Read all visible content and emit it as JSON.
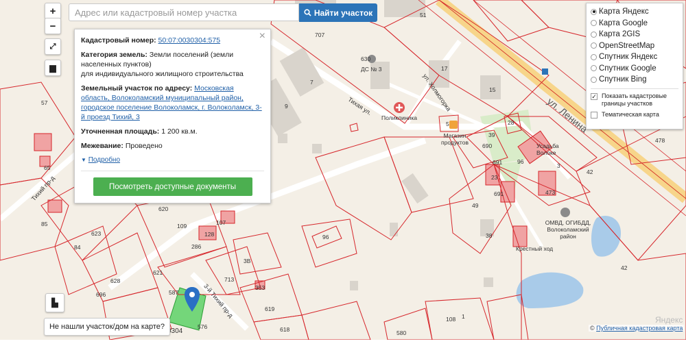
{
  "search": {
    "placeholder": "Адрес или кадастровый номер участка",
    "button_label": "Найти участок"
  },
  "map_controls": {
    "zoom_in": "+",
    "zoom_out": "−"
  },
  "info_popup": {
    "cadastral_label": "Кадастровый номер:",
    "cadastral_value": "50:07:0030304:575",
    "category_label": "Категория земель:",
    "category_value": "Земли поселений (земли населенных пунктов)",
    "usage_value": "для индивидуального жилищного строительства",
    "address_label": "Земельный участок по адресу:",
    "address_value": "Московская область, Волоколамский муниципальный район, городское поселение Волоколамск, г. Волоколамск, 3-й проезд Тихий, 3",
    "area_label": "Уточненная площадь:",
    "area_value": "1 200 кв.м.",
    "survey_label": "Межевание:",
    "survey_value": "Проведено",
    "more_label": "Подробно",
    "docs_button": "Посмотреть доступные документы",
    "close": "×"
  },
  "layers": {
    "options": [
      {
        "label": "Карта Яндекс",
        "selected": true
      },
      {
        "label": "Карта Google",
        "selected": false
      },
      {
        "label": "Карта 2GIS",
        "selected": false
      },
      {
        "label": "OpenStreetMap",
        "selected": false
      },
      {
        "label": "Спутник Яндекс",
        "selected": false
      },
      {
        "label": "Спутник Google",
        "selected": false
      },
      {
        "label": "Спутник Bing",
        "selected": false
      }
    ],
    "show_cadastral": {
      "label": "Показать кадастровые границы участков",
      "checked": true
    },
    "thematic": {
      "label": "Тематическая карта",
      "checked": false
    }
  },
  "not_found_button": "Не нашли участок/дом на карте?",
  "copyright": {
    "prefix": "©",
    "link": "Публичная кадастровая карта"
  },
  "map_labels": {
    "street_lenina": "ул. Ленина",
    "street_tikhaya": "Тихая ул.",
    "street_kholmogorka": "ул. Холмогорка",
    "street_3_tikhy": "3-й Тихий пр-д",
    "street_tikhy_left": "Тихий пр-д",
    "poi_ds3": "ДС № 3",
    "poi_clinic": "Поликлиника",
    "poi_shop": "Магазин продуктов",
    "poi_omvd": "ОМВД, ОГИБДД, Волоколамский район",
    "poi_usadba": "Усадьба Волоке",
    "poi_church": "Крестный ход",
    "yandex_mark": "Яндекс",
    "parcel_code": "0304",
    "numbers": [
      "51",
      "707",
      "17",
      "15",
      "7",
      "9",
      "630",
      "5",
      "57",
      "65",
      "23",
      "39",
      "28",
      "690",
      "691",
      "691",
      "473",
      "96",
      "3",
      "42",
      "49",
      "620",
      "109",
      "107",
      "128",
      "286",
      "85",
      "84",
      "623",
      "621",
      "696",
      "628",
      "587",
      "713",
      "576",
      "353",
      "619",
      "618",
      "38",
      "580",
      "108",
      "42",
      "96",
      "1",
      "478",
      "3B"
    ]
  },
  "colors": {
    "primary": "#2c74b8",
    "green": "#4caf50",
    "cadastral_line": "#d6262b",
    "selected_parcel": "#74d67a",
    "water": "#a9cbe9",
    "marker": "#2a6fc4"
  }
}
